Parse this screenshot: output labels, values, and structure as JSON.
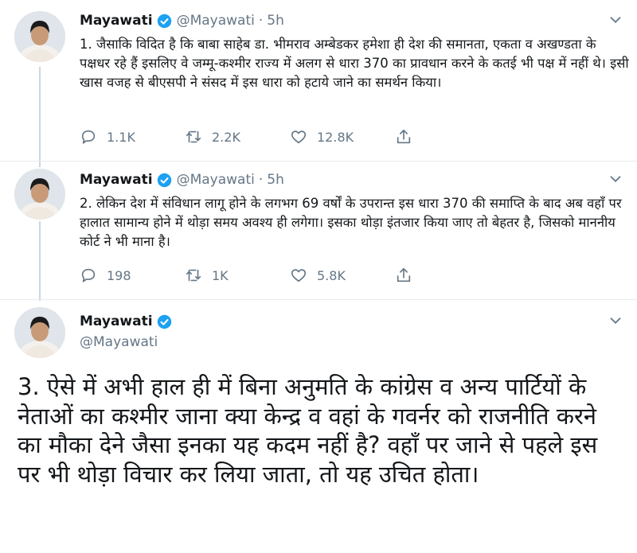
{
  "account": {
    "name": "Mayawati",
    "handle": "@Mayawati"
  },
  "tweets": [
    {
      "dot": "·",
      "time": "5h",
      "text": "1. जैसाकि विदित है कि बाबा साहेब डा. भीमराव अम्बेडकर हमेशा ही देश की समानता, एकता व अखण्डता के पक्षधर रहे हैं इसलिए वे जम्मू-कश्मीर राज्य में अलग से धारा 370 का प्रावधान करने के कतई भी पक्ष में नहीं थे। इसी खास वजह से बीएसपी ने संसद में इस धारा को हटाये जाने का समर्थन किया।",
      "replies": "1.1K",
      "retweets": "2.2K",
      "likes": "12.8K"
    },
    {
      "dot": "·",
      "time": "5h",
      "text": "2. लेकिन देश में संविधान लागू होने के लगभग 69 वर्षों के उपरान्त इस धारा 370 की समाप्ति के बाद अब वहाँ पर हालात सामान्य होने में थोड़ा समय अवश्य ही लगेगा। इसका थोड़ा इंतजार किया जाए तो बेहतर है, जिसको माननीय कोर्ट ने भी माना है।",
      "replies": "198",
      "retweets": "1K",
      "likes": "5.8K"
    },
    {
      "text": "3. ऐसे में अभी हाल ही में बिना अनुमति के कांग्रेस व अन्य पार्टियों के नेताओं का कश्मीर जाना क्या केन्द्र व वहां के गवर्नर को राजनीति करने का मौका देने जैसा इनका यह कदम नहीं है? वहाँ पर जाने से पहले इस पर भी थोड़ा विचार कर लिया जाता, तो यह उचित होता।"
    }
  ],
  "colors": {
    "verified": "#1da1f2",
    "muted": "#657786",
    "thread_line": "#ccd6dd",
    "divider": "#e6ecf0"
  },
  "icons": [
    "avatar",
    "verified-badge-icon",
    "chevron-down-icon",
    "reply-icon",
    "retweet-icon",
    "like-icon",
    "share-icon"
  ]
}
